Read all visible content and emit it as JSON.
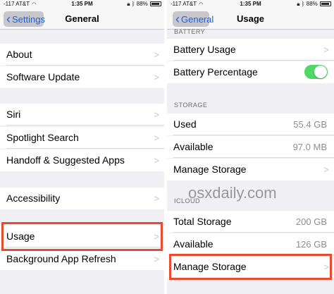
{
  "left": {
    "status": {
      "carrier": "-117 AT&T",
      "wifi_icon": "wifi-icon",
      "time": "1:35 PM",
      "battery": "88%"
    },
    "nav": {
      "back": "Settings",
      "title": "General"
    },
    "rows": [
      {
        "label": "About"
      },
      {
        "label": "Software Update"
      },
      {
        "label": "Siri"
      },
      {
        "label": "Spotlight Search"
      },
      {
        "label": "Handoff & Suggested Apps"
      },
      {
        "label": "Accessibility"
      },
      {
        "label": "Usage"
      },
      {
        "label": "Background App Refresh"
      }
    ]
  },
  "right": {
    "status": {
      "carrier": "-117 AT&T",
      "wifi_icon": "wifi-icon",
      "time": "1:35 PM",
      "battery": "88%"
    },
    "nav": {
      "back": "General",
      "title": "Usage"
    },
    "sections": {
      "battery": "BATTERY",
      "storage": "STORAGE",
      "icloud": "ICLOUD"
    },
    "rows": {
      "battery_usage": "Battery Usage",
      "battery_percentage": "Battery Percentage",
      "used": "Used",
      "used_value": "55.4 GB",
      "available": "Available",
      "available_value": "97.0 MB",
      "manage_storage": "Manage Storage",
      "total_storage": "Total Storage",
      "total_storage_value": "200 GB",
      "icloud_available": "Available",
      "icloud_available_value": "126 GB",
      "icloud_manage_storage": "Manage Storage"
    },
    "toggle_on": true
  },
  "watermark": "osxdaily.com",
  "colors": {
    "highlight": "#e84b2f",
    "toggle": "#4cd964",
    "link": "#1a62e0"
  }
}
